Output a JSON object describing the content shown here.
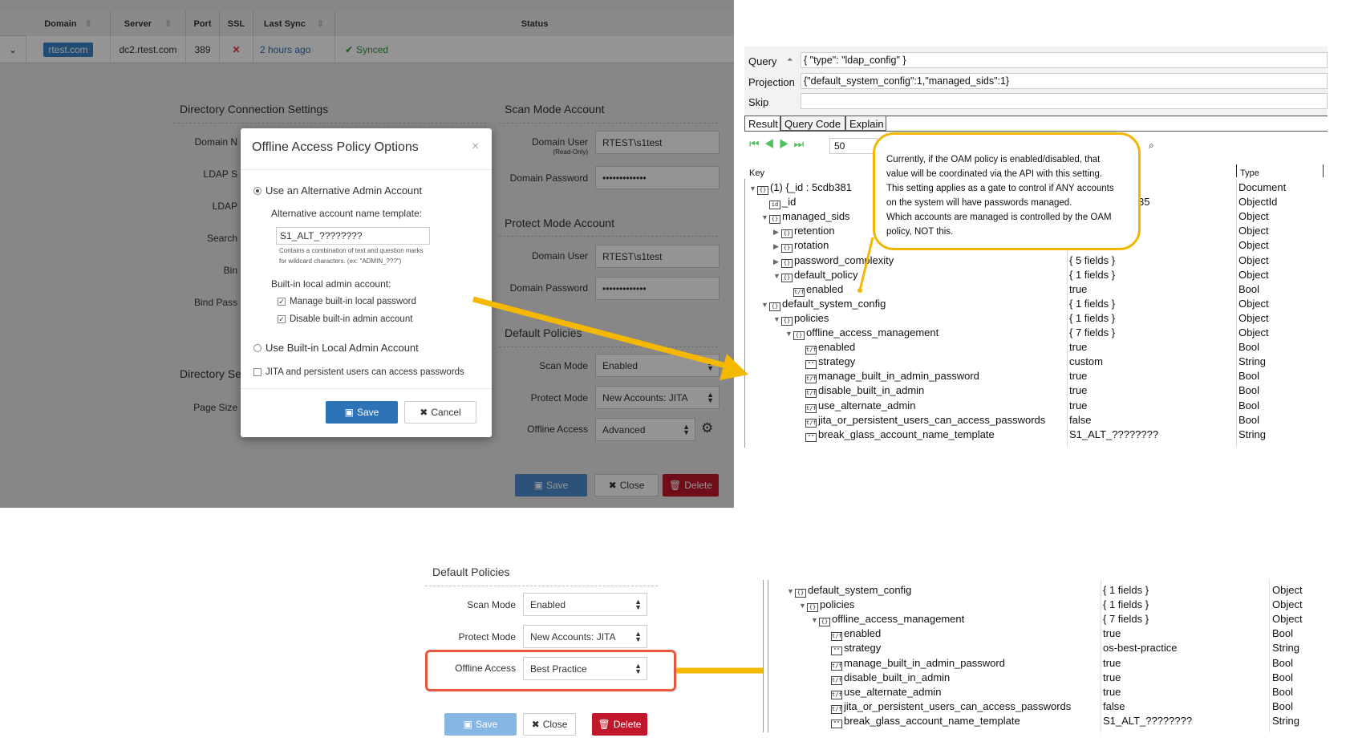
{
  "top_table": {
    "headers": [
      "Domain",
      "Server",
      "Port",
      "SSL",
      "Last Sync",
      "Status"
    ],
    "row": {
      "domain": "rtest.com",
      "server": "dc2.rtest.com",
      "port": "389",
      "ssl": "✕",
      "last_sync": "2 hours ago",
      "status": "Synced"
    }
  },
  "settings": {
    "dir_conn_title": "Directory Connection Settings",
    "left_labels": [
      "Domain N",
      "LDAP S",
      "LDAP",
      "Search",
      "Bin",
      "Bind Pass"
    ],
    "dir_settings_title": "Directory Se",
    "page_size_label": "Page Size",
    "scan_title": "Scan Mode Account",
    "domain_user_label": "Domain User",
    "read_only": "(Read-Only)",
    "domain_user_value": "RTEST\\s1test",
    "domain_password_label": "Domain Password",
    "password_value": "•••••••••••••",
    "protect_title": "Protect Mode Account",
    "default_policies_title": "Default Policies",
    "scan_mode_label": "Scan Mode",
    "scan_mode_value": "Enabled",
    "protect_mode_label": "Protect Mode",
    "protect_mode_value": "New Accounts: JITA",
    "offline_access_label": "Offline Access",
    "offline_access_value": "Advanced",
    "save": "Save",
    "close": "Close",
    "delete": "Delete"
  },
  "modal": {
    "title": "Offline Access Policy Options",
    "close": "×",
    "opt_alt": "Use an Alternative Admin Account",
    "alt_template_label": "Alternative account name template:",
    "alt_template_value": "S1_ALT_????????",
    "help1": "Contains a combination of text and question marks",
    "help2": "for wildcard characters. (ex: \"ADMIN_???\")",
    "builtin_label": "Built-in local admin account:",
    "chk_manage": "Manage built-in local password",
    "chk_disable": "Disable built-in admin account",
    "opt_builtin": "Use Built-in Local Admin Account",
    "chk_jita": "JITA and persistent users can access passwords",
    "save": "Save",
    "cancel": "Cancel"
  },
  "query": {
    "query_label": "Query",
    "query_value": "{ \"type\": \"ldap_config\" }",
    "projection_label": "Projection",
    "projection_value": "{\"default_system_config\":1,\"managed_sids\":1}",
    "skip_label": "Skip",
    "tabs": [
      "Result",
      "Query Code",
      "Explain"
    ],
    "page_size": "50",
    "col_key": "Key",
    "col_type": "Type"
  },
  "tree_top": [
    {
      "indent": 0,
      "tri": "▼",
      "icon": "{}",
      "key": "(1) {_id : 5cdb381",
      "value": "",
      "type": "Document"
    },
    {
      "indent": 1,
      "tri": "",
      "icon": "id",
      "key": "_id",
      "value": "f71f800583c2135",
      "type": "ObjectId"
    },
    {
      "indent": 1,
      "tri": "▼",
      "icon": "{}",
      "key": "managed_sids",
      "value": "",
      "type": "Object"
    },
    {
      "indent": 2,
      "tri": "▶",
      "icon": "{}",
      "key": "retention",
      "value": "",
      "type": "Object"
    },
    {
      "indent": 2,
      "tri": "▶",
      "icon": "{}",
      "key": "rotation",
      "value": "",
      "type": "Object"
    },
    {
      "indent": 2,
      "tri": "▶",
      "icon": "{}",
      "key": "password_complexity",
      "value": "{ 5 fields }",
      "type": "Object"
    },
    {
      "indent": 2,
      "tri": "▼",
      "icon": "{}",
      "key": "default_policy",
      "value": "{ 1 fields }",
      "type": "Object"
    },
    {
      "indent": 3,
      "tri": "",
      "icon": "t/f",
      "key": "enabled",
      "value": "true",
      "type": "Bool"
    },
    {
      "indent": 1,
      "tri": "▼",
      "icon": "{}",
      "key": "default_system_config",
      "value": "{ 1 fields }",
      "type": "Object"
    },
    {
      "indent": 2,
      "tri": "▼",
      "icon": "{}",
      "key": "policies",
      "value": "{ 1 fields }",
      "type": "Object"
    },
    {
      "indent": 3,
      "tri": "▼",
      "icon": "{}",
      "key": "offline_access_management",
      "value": "{ 7 fields }",
      "type": "Object"
    },
    {
      "indent": 4,
      "tri": "",
      "icon": "t/f",
      "key": "enabled",
      "value": "true",
      "type": "Bool"
    },
    {
      "indent": 4,
      "tri": "",
      "icon": "\"\"",
      "key": "strategy",
      "value": "custom",
      "type": "String"
    },
    {
      "indent": 4,
      "tri": "",
      "icon": "t/f",
      "key": "manage_built_in_admin_password",
      "value": "true",
      "type": "Bool"
    },
    {
      "indent": 4,
      "tri": "",
      "icon": "t/f",
      "key": "disable_built_in_admin",
      "value": "true",
      "type": "Bool"
    },
    {
      "indent": 4,
      "tri": "",
      "icon": "t/f",
      "key": "use_alternate_admin",
      "value": "true",
      "type": "Bool"
    },
    {
      "indent": 4,
      "tri": "",
      "icon": "t/f",
      "key": "jita_or_persistent_users_can_access_passwords",
      "value": "false",
      "type": "Bool"
    },
    {
      "indent": 4,
      "tri": "",
      "icon": "\"\"",
      "key": "break_glass_account_name_template",
      "value": "S1_ALT_????????",
      "type": "String"
    }
  ],
  "callout": [
    "Currently, if the OAM policy is enabled/disabled, that",
    "value will be coordinated via the API with this setting.",
    "This setting applies as a gate to control if ANY accounts",
    "on the system will have passwords managed.",
    "Which accounts are managed is controlled by the OAM",
    "policy, NOT this."
  ],
  "bottom": {
    "title": "Default Policies",
    "scan_mode_label": "Scan Mode",
    "scan_mode_value": "Enabled",
    "protect_mode_label": "Protect Mode",
    "protect_mode_value": "New Accounts: JITA",
    "offline_access_label": "Offline Access",
    "offline_access_value": "Best Practice",
    "save": "Save",
    "close": "Close",
    "delete": "Delete"
  },
  "tree_bottom": [
    {
      "indent": 0,
      "tri": "▼",
      "icon": "{}",
      "key": "default_system_config",
      "value": "{ 1 fields }",
      "type": "Object"
    },
    {
      "indent": 1,
      "tri": "▼",
      "icon": "{}",
      "key": "policies",
      "value": "{ 1 fields }",
      "type": "Object"
    },
    {
      "indent": 2,
      "tri": "▼",
      "icon": "{}",
      "key": "offline_access_management",
      "value": "{ 7 fields }",
      "type": "Object"
    },
    {
      "indent": 3,
      "tri": "",
      "icon": "t/f",
      "key": "enabled",
      "value": "true",
      "type": "Bool"
    },
    {
      "indent": 3,
      "tri": "",
      "icon": "\"\"",
      "key": "strategy",
      "value": "os-best-practice",
      "type": "String"
    },
    {
      "indent": 3,
      "tri": "",
      "icon": "t/f",
      "key": "manage_built_in_admin_password",
      "value": "true",
      "type": "Bool"
    },
    {
      "indent": 3,
      "tri": "",
      "icon": "t/f",
      "key": "disable_built_in_admin",
      "value": "true",
      "type": "Bool"
    },
    {
      "indent": 3,
      "tri": "",
      "icon": "t/f",
      "key": "use_alternate_admin",
      "value": "true",
      "type": "Bool"
    },
    {
      "indent": 3,
      "tri": "",
      "icon": "t/f",
      "key": "jita_or_persistent_users_can_access_passwords",
      "value": "false",
      "type": "Bool"
    },
    {
      "indent": 3,
      "tri": "",
      "icon": "\"\"",
      "key": "break_glass_account_name_template",
      "value": "S1_ALT_????????",
      "type": "String"
    }
  ],
  "colors": {
    "accent": "#f5b800",
    "highlight": "#e8563f",
    "primary": "#2d73b8",
    "danger": "#c0172b"
  }
}
